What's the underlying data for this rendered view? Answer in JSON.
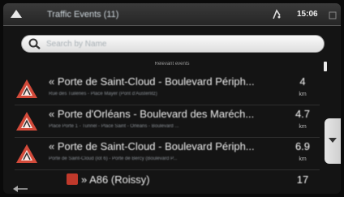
{
  "header": {
    "title": "Traffic Events (11)",
    "clock": "15:06"
  },
  "search": {
    "placeholder": "Search by Name"
  },
  "section_label": "Relevant events",
  "events": [
    {
      "title": "« Porte de Saint-Cloud - Boulevard Périph...",
      "subtitle": "Rue des Tuileries - Place Mayer (Pont d'Austerlitz)",
      "distance": "4",
      "unit": "km"
    },
    {
      "title": "« Porte d'Orléans - Boulevard des Maréch...",
      "subtitle": "Place Porte 1 - Tunnel - Place Saint - Orléans - Boulevard ...",
      "distance": "4.7",
      "unit": "km"
    },
    {
      "title": "« Porte de Saint-Cloud - Boulevard Périph...",
      "subtitle": "Porte de Saint-Cloud (lot 6) - Porte de Bercy (Boulevard P...",
      "distance": "6.9",
      "unit": "km"
    },
    {
      "title": "» A86 (Roissy)",
      "subtitle": "",
      "distance": "17",
      "unit": "km"
    }
  ],
  "colors": {
    "warning_red": "#c0392b",
    "header_bg": "#2f2f2f",
    "list_bg": "#141414"
  },
  "icons": {
    "back": "triangle-up-icon",
    "gps": "gps-signal-icon",
    "cube": "cube-icon",
    "search": "magnifier-icon",
    "event": "roadworks-warning-icon",
    "scroll_down": "chevron-down-icon"
  }
}
